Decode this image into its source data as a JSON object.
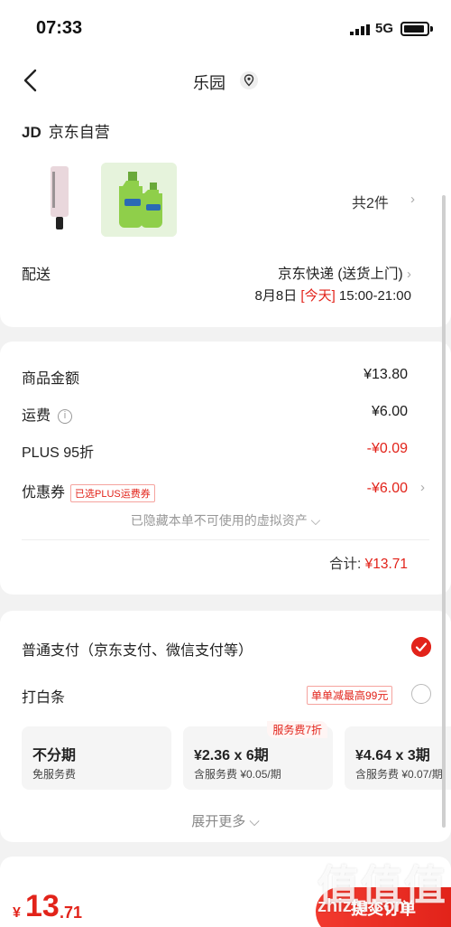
{
  "status_bar": {
    "time": "07:33",
    "network": "5G"
  },
  "nav": {
    "title": "乐园"
  },
  "shop": {
    "logo": "JD",
    "name": "京东自营"
  },
  "items": {
    "count_label": "共2件"
  },
  "delivery": {
    "label": "配送",
    "method": "京东快递 (送货上门)",
    "date": "8月8日",
    "today": "[今天]",
    "time_window": "15:00-21:00"
  },
  "summary": {
    "goods_label": "商品金额",
    "goods_value": "¥13.80",
    "shipping_label": "运费",
    "shipping_value": "¥6.00",
    "plus_label": "PLUS 95折",
    "plus_value": "-¥0.09",
    "coupon_label": "优惠券",
    "coupon_tag": "已选PLUS运费券",
    "coupon_value": "-¥6.00",
    "hidden_assets": "已隐藏本单不可使用的虚拟资产 ⌵",
    "total_label": "合计:",
    "total_value": "¥13.71"
  },
  "payment": {
    "normal_label": "普通支付（京东支付、微信支付等）",
    "baitiao_label": "打白条",
    "baitiao_promo": "单单减最高99元",
    "installments": [
      {
        "main": "不分期",
        "sub": "免服务费",
        "tag": ""
      },
      {
        "main": "¥2.36 x 6期",
        "sub": "含服务费 ¥0.05/期",
        "tag": "服务费7折"
      },
      {
        "main": "¥4.64 x 3期",
        "sub": "含服务费 ¥0.07/期",
        "tag": ""
      }
    ],
    "expand_label": "展开更多 ⌵"
  },
  "footer": {
    "currency": "¥",
    "price_int": "13",
    "price_dec": ".71",
    "submit_label": "提交订单"
  },
  "watermark": {
    "text": "值",
    "site": "zhiztu.com"
  },
  "colors": {
    "accent": "#e2231a",
    "background": "#f2f2f2"
  },
  "icons": [
    "signal-icon",
    "battery-icon",
    "back-icon",
    "location-icon",
    "info-icon",
    "chevron-right-icon",
    "check-icon"
  ]
}
